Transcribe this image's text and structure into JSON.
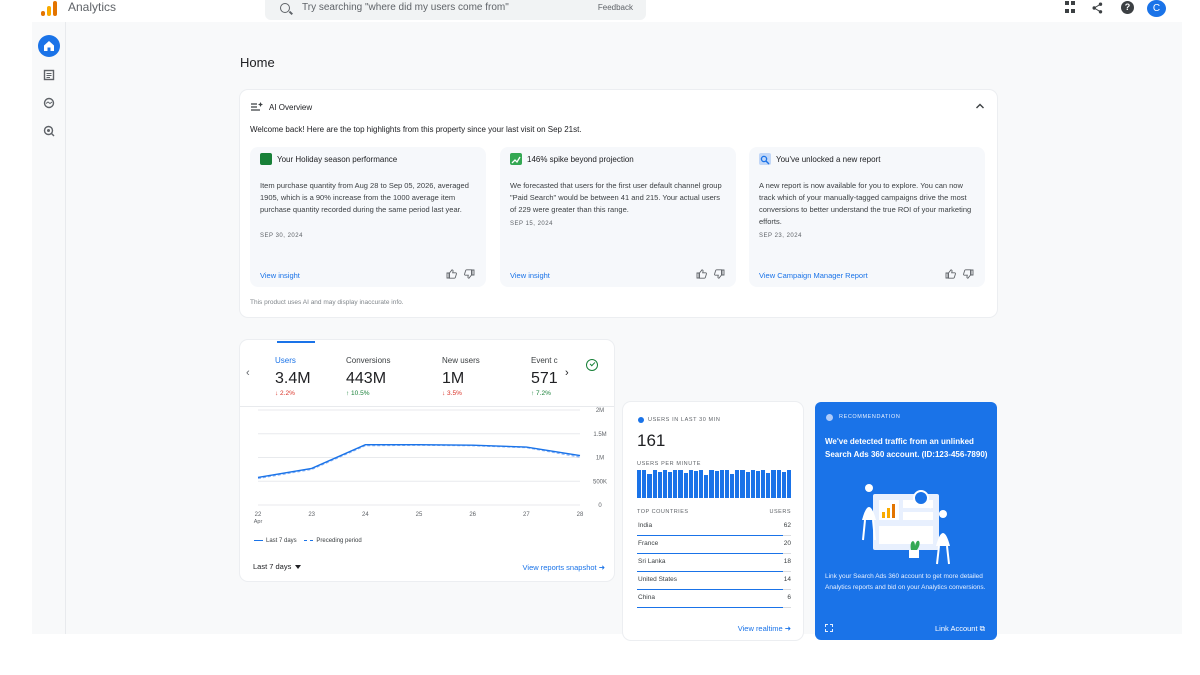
{
  "header": {
    "app_name": "Analytics",
    "search_placeholder": "Try searching \"where did my users come from\"",
    "feedback_label": "Feedback",
    "avatar_initial": "C",
    "help_glyph": "?"
  },
  "page": {
    "title": "Home"
  },
  "ai_overview": {
    "title": "AI Overview",
    "welcome": "Welcome back! Here are the top highlights from this property since your last visit on Sep 21st.",
    "footer": "This product uses AI and may display inaccurate info.",
    "insights": [
      {
        "title": "Your Holiday season performance",
        "icon": "holiday-icon",
        "icon_color": "#188038",
        "body": "Item purchase quantity from Aug 28 to Sep 05, 2026, averaged 1905, which is a 90% increase from the 1000 average item purchase quantity recorded during the same period last year.",
        "date": "SEP 30, 2024",
        "link": "View insight"
      },
      {
        "title": "146% spike beyond projection",
        "icon": "trend-up-icon",
        "icon_color": "#34a853",
        "body": "We forecasted that users for the first user default channel group \"Paid Search\" would be between 41 and 215. Your actual users of 229 were greater than this range.",
        "date": "SEP 15, 2024",
        "link": "View insight"
      },
      {
        "title": "You've unlocked a new report",
        "icon": "report-search-icon",
        "icon_color": "#c2d7f7",
        "body": "A new report is now available for you to explore. You can now track which of your manually-tagged campaigns drive the most conversions to better understand the true ROI of your marketing efforts.",
        "date": "SEP 23, 2024",
        "link": "View Campaign Manager Report"
      }
    ]
  },
  "metrics": {
    "items": [
      {
        "label": "Users",
        "value": "3.4M",
        "change": "↓ 2.2%",
        "direction": "down"
      },
      {
        "label": "Conversions",
        "value": "443M",
        "change": "↑ 10.5%",
        "direction": "up"
      },
      {
        "label": "New users",
        "value": "1M",
        "change": "↓ 3.5%",
        "direction": "down"
      },
      {
        "label": "Event c",
        "value": "571",
        "change": "↑ 7.2%",
        "direction": "up"
      }
    ],
    "legend_current": "Last 7 days",
    "legend_previous": "Preceding period",
    "date_range": "Last 7 days",
    "link": "View reports snapshot"
  },
  "chart_data": {
    "type": "line",
    "x": [
      "22",
      "23",
      "24",
      "25",
      "26",
      "27",
      "28"
    ],
    "x_sublabel": "Apr",
    "y_ticks": [
      "0",
      "500K",
      "1M",
      "1.5M",
      "2M"
    ],
    "ylim": [
      0,
      2000000
    ],
    "series": [
      {
        "name": "Last 7 days",
        "values": [
          580000,
          770000,
          1270000,
          1270000,
          1260000,
          1220000,
          1040000
        ]
      },
      {
        "name": "Preceding period",
        "values": [
          560000,
          750000,
          1250000,
          1260000,
          1250000,
          1210000,
          1010000
        ]
      }
    ]
  },
  "realtime": {
    "label": "USERS IN LAST 30 MIN",
    "value": "161",
    "per_minute_label": "USERS PER MINUTE",
    "per_minute": [
      30,
      30,
      26,
      30,
      28,
      30,
      28,
      30,
      30,
      27,
      30,
      29,
      30,
      25,
      30,
      29,
      30,
      30,
      26,
      30,
      30,
      28,
      30,
      29,
      30,
      27,
      30,
      30,
      28,
      30
    ],
    "col_country": "TOP COUNTRIES",
    "col_users": "USERS",
    "countries": [
      {
        "name": "India",
        "users": "62",
        "share": 1.0
      },
      {
        "name": "France",
        "users": "20",
        "share": 1.0
      },
      {
        "name": "Sri Lanka",
        "users": "18",
        "share": 1.0
      },
      {
        "name": "United States",
        "users": "14",
        "share": 1.0
      },
      {
        "name": "China",
        "users": "6",
        "share": 1.0
      }
    ],
    "link": "View realtime"
  },
  "recommendation": {
    "label": "RECOMMENDATION",
    "title": "We've detected traffic from an unlinked Search Ads 360 account. (ID:123-456-7890)",
    "body": "Link your Search Ads 360 account to get more detailed Analytics reports and bid on your Analytics conversions.",
    "link": "Link Account"
  },
  "colors": {
    "accent": "#1a73e8",
    "positive": "#188038",
    "negative": "#d93025"
  }
}
